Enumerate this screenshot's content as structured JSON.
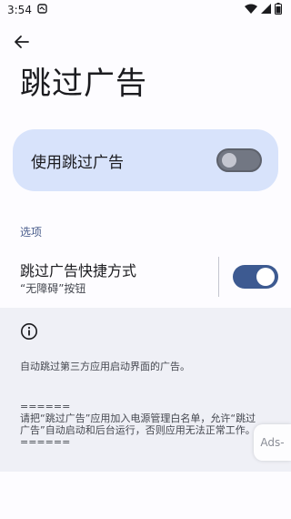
{
  "status_bar": {
    "time": "3:54",
    "icons": [
      "notification-icon",
      "wifi-icon",
      "signal-icon",
      "battery-icon"
    ]
  },
  "toolbar": {
    "back_icon": "arrow-back-icon"
  },
  "page": {
    "title": "跳过广告"
  },
  "main_switch": {
    "label": "使用跳过广告",
    "enabled": false
  },
  "section": {
    "header": "选项"
  },
  "shortcut_pref": {
    "title": "跳过广告快捷方式",
    "summary": "“无障碍”按钮",
    "enabled": true
  },
  "info": {
    "icon": "info-icon",
    "description": "自动跳过第三方应用启动界面的广告。",
    "note": "======\n请把“跳过广告”应用加入电源管理白名单，允许“跳过广告”自动启动和后台运行，否则应用无法正常工作。\n======"
  },
  "overlay": {
    "ads_label": "Ads-"
  },
  "colors": {
    "accent": "#3d5a91",
    "card_bg": "#d8e3fb",
    "section_header": "#4a5d8c",
    "info_bg": "#eff0f6"
  }
}
